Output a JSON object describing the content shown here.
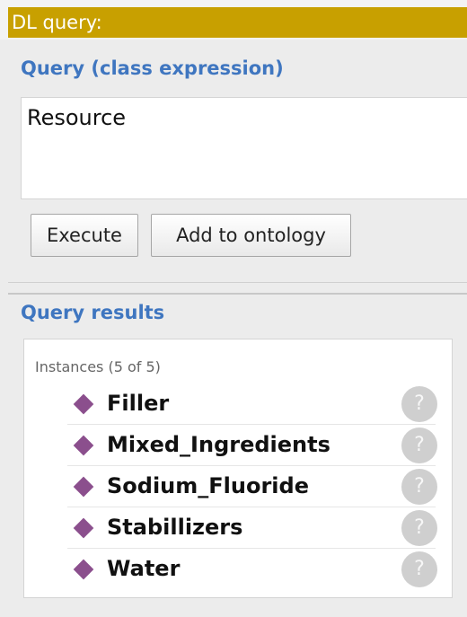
{
  "view": {
    "title": "DL query:"
  },
  "query": {
    "section_label": "Query (class expression)",
    "expression": "Resource",
    "execute_label": "Execute",
    "add_to_ontology_label": "Add to ontology"
  },
  "results": {
    "section_label": "Query results",
    "instances_header": "Instances (5 of 5)",
    "items": [
      {
        "label": "Filler",
        "icon": "individual-diamond-icon",
        "help": "?"
      },
      {
        "label": "Mixed_Ingredients",
        "icon": "individual-diamond-icon",
        "help": "?"
      },
      {
        "label": "Sodium_Fluoride",
        "icon": "individual-diamond-icon",
        "help": "?"
      },
      {
        "label": "Stabillizers",
        "icon": "individual-diamond-icon",
        "help": "?"
      },
      {
        "label": "Water",
        "icon": "individual-diamond-icon",
        "help": "?"
      }
    ]
  },
  "colors": {
    "title_bar": "#c8a000",
    "section_label": "#3f76c0",
    "individual_icon": "#8b4f8d"
  }
}
